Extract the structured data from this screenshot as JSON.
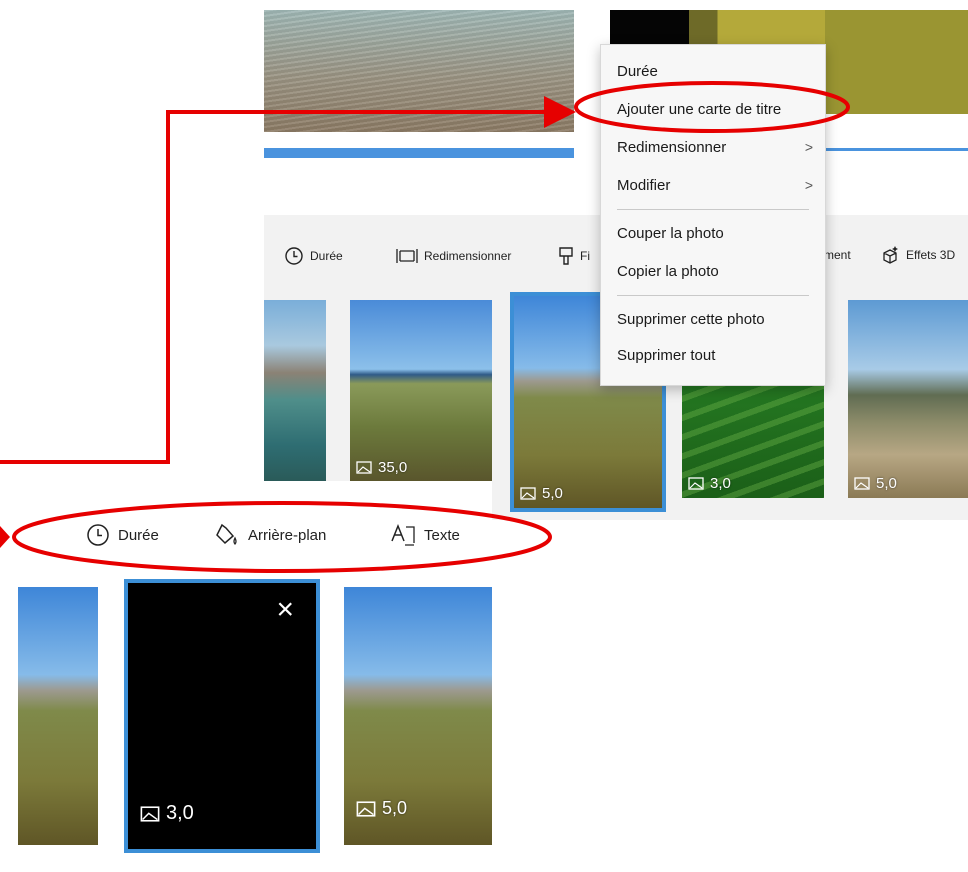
{
  "context_menu": {
    "items": [
      {
        "label": "Durée"
      },
      {
        "label": "Ajouter une carte de titre"
      },
      {
        "label": "Redimensionner",
        "submenu": true
      },
      {
        "label": "Modifier",
        "submenu": true
      },
      {
        "label": "Couper la photo"
      },
      {
        "label": "Copier la photo"
      },
      {
        "label": "Supprimer cette photo"
      },
      {
        "label": "Supprimer tout"
      }
    ],
    "submenu_arrow": ">"
  },
  "top_toolbar": {
    "duration_label": "Durée",
    "resize_label": "Redimensionner",
    "filters_label": "Fi",
    "motion_label": "ment",
    "effects3d_label": "Effets 3D"
  },
  "top_thumbnails": [
    {
      "duration": ""
    },
    {
      "duration": "35,0"
    },
    {
      "duration": "5,0",
      "selected": true
    },
    {
      "duration": "3,0"
    },
    {
      "duration": "5,0"
    }
  ],
  "bottom_toolbar": {
    "duration_label": "Durée",
    "background_label": "Arrière-plan",
    "text_label": "Texte"
  },
  "bottom_thumbnails": [
    {
      "duration": ""
    },
    {
      "duration": "3,0",
      "selected": true,
      "close": "×"
    },
    {
      "duration": "5,0"
    }
  ],
  "colors": {
    "annotation_red": "#e60000",
    "selection_blue": "#3c8fd6"
  },
  "icons": [
    "clock-icon",
    "resize-icon",
    "filter-icon",
    "effects-3d-icon",
    "paint-bucket-icon",
    "text-icon",
    "image-icon",
    "close-icon",
    "chevron-right-icon"
  ]
}
